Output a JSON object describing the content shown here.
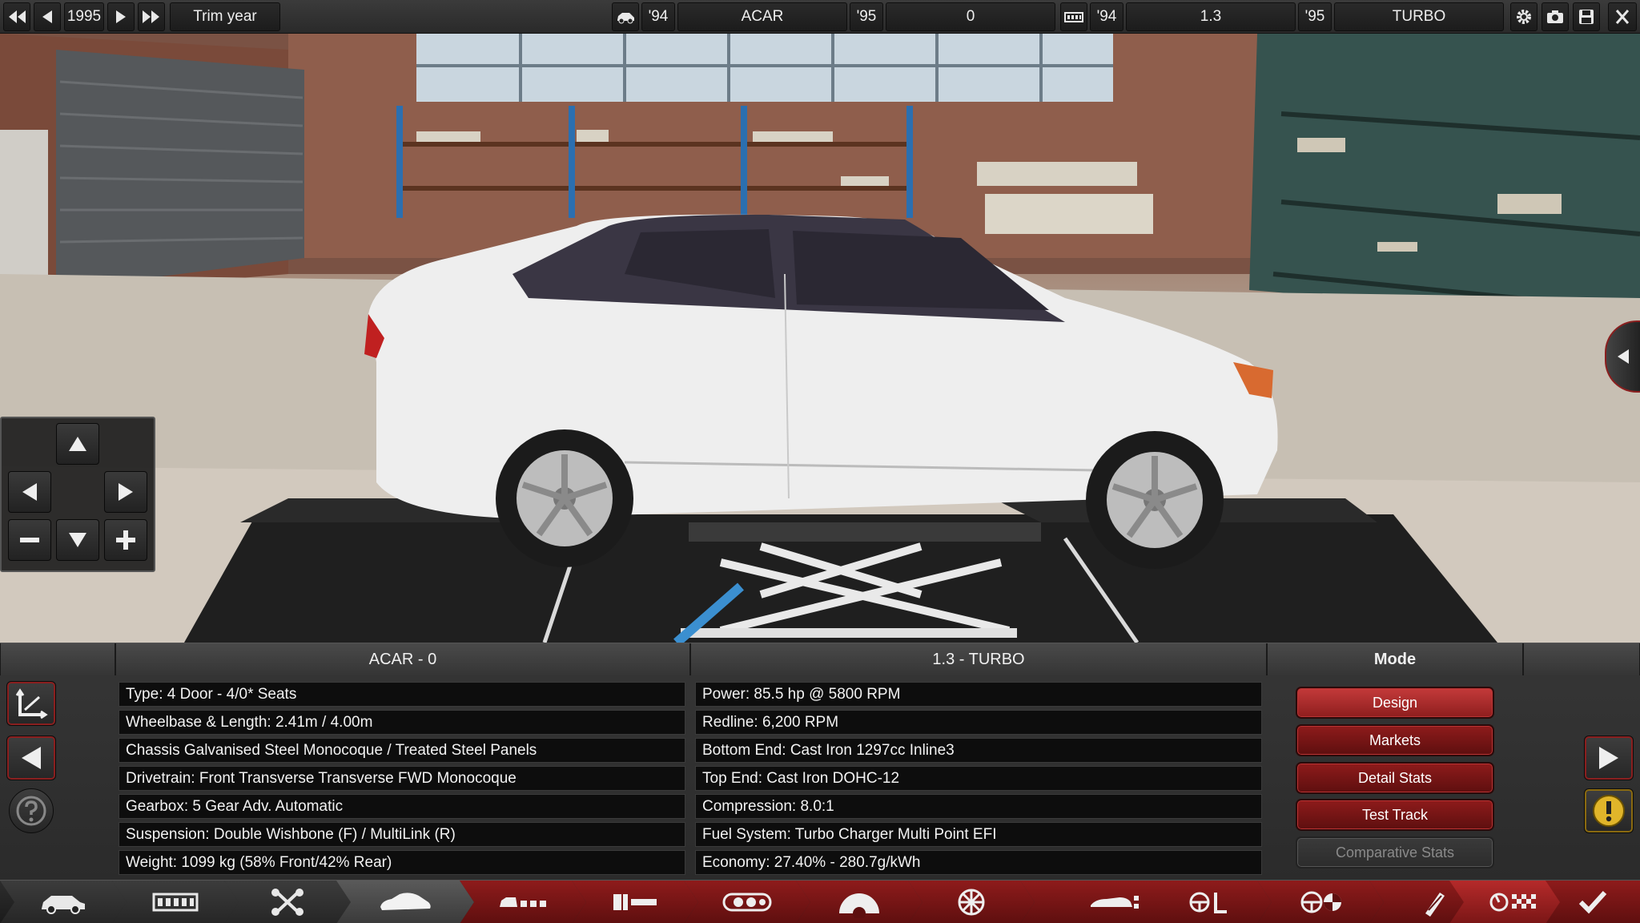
{
  "topbar": {
    "year": "1995",
    "trim_year_label": "Trim year",
    "model_year": "'94",
    "model_name": "ACAR",
    "trim_year": "'95",
    "trim_name": "0",
    "engine_family_year": "'94",
    "engine_family_name": "1.3",
    "engine_variant_year": "'95",
    "engine_variant_name": "TURBO"
  },
  "panel": {
    "car_header": "ACAR - 0",
    "engine_header": "1.3 - TURBO",
    "mode_header": "Mode",
    "car_stats": [
      "Type: 4 Door - 4/0* Seats",
      "Wheelbase & Length: 2.41m / 4.00m",
      "Chassis Galvanised Steel Monocoque / Treated Steel Panels",
      "Drivetrain: Front Transverse Transverse FWD Monocoque",
      "Gearbox: 5 Gear Adv. Automatic",
      "Suspension: Double Wishbone (F) / MultiLink (R)",
      "Weight: 1099 kg (58% Front/42% Rear)"
    ],
    "engine_stats": [
      "Power: 85.5 hp @ 5800 RPM",
      "Redline:  6,200 RPM",
      "Bottom End: Cast Iron 1297cc Inline3",
      "Top End: Cast Iron DOHC-12",
      "Compression: 8.0:1",
      "Fuel System: Turbo Charger Multi Point EFI",
      "Economy: 27.40% - 280.7g/kWh"
    ],
    "modes": [
      "Design",
      "Markets",
      "Detail Stats",
      "Test Track",
      "Comparative Stats"
    ]
  },
  "tabs": [
    {
      "icon": "car-model-icon"
    },
    {
      "icon": "chassis-icon"
    },
    {
      "icon": "suspension-icon"
    },
    {
      "icon": "body-icon"
    },
    {
      "icon": "fixtures-icon"
    },
    {
      "icon": "interior-icon"
    },
    {
      "icon": "engine-icon"
    },
    {
      "icon": "gearbox-icon"
    },
    {
      "icon": "wheels-icon"
    },
    {
      "icon": "brakes-icon"
    },
    {
      "icon": "aero-icon"
    },
    {
      "icon": "drivetrain-icon"
    },
    {
      "icon": "safety-icon"
    },
    {
      "icon": "tuning-icon"
    },
    {
      "icon": "testing-icon"
    },
    {
      "icon": "finish-icon"
    }
  ],
  "colors": {
    "accent_red": "#8e1b1b",
    "active_red": "#c43a3a",
    "dark": "#0d0d0d",
    "car_white": "#eeeeee",
    "warning_yellow": "#e0b52a"
  }
}
